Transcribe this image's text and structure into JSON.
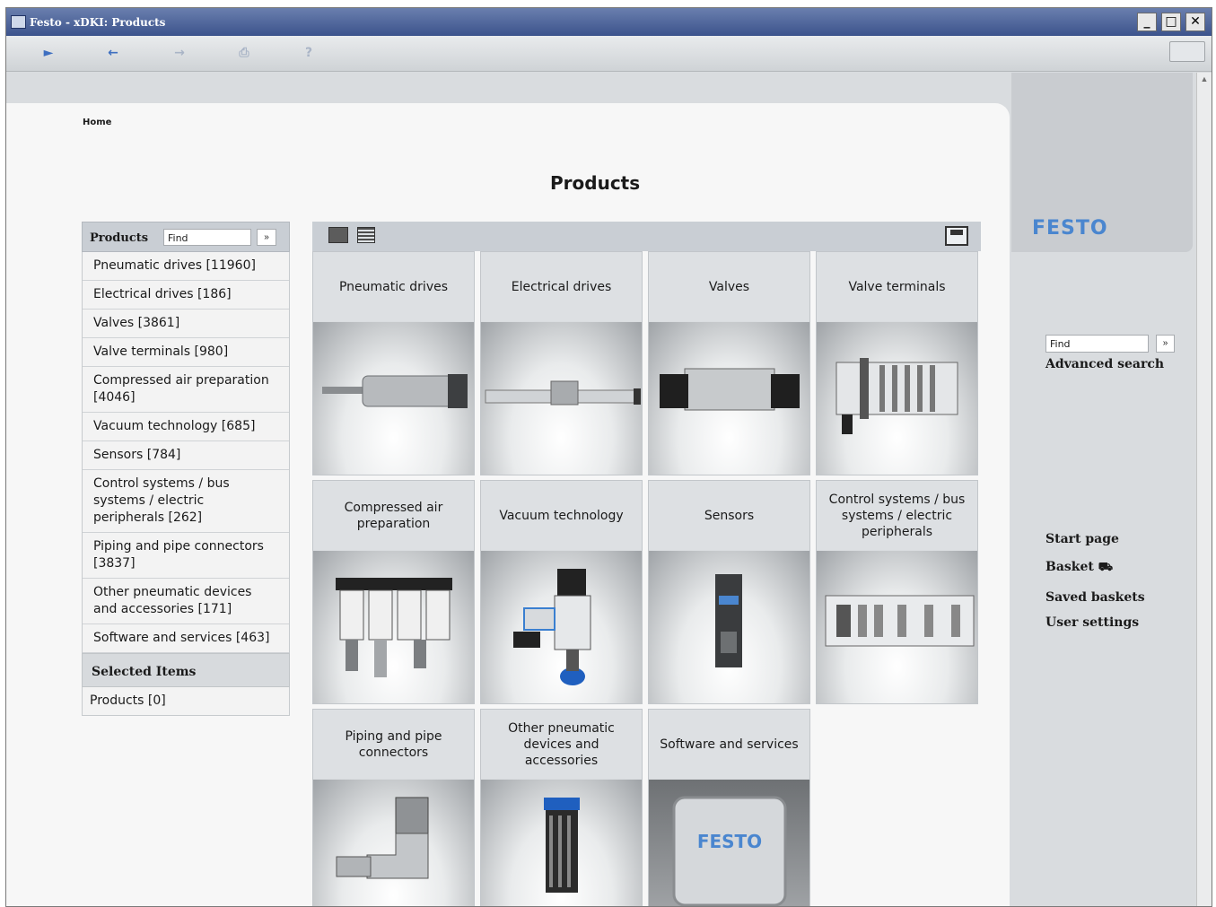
{
  "window": {
    "title": "Festo - xDKI: Products",
    "controls": {
      "minimize": "_",
      "maximize": "□",
      "close": "✕"
    }
  },
  "toolbar": {
    "home_icon": "home-arrow-icon",
    "back_icon": "back-arrow-icon",
    "forward_icon": "forward-arrow-icon",
    "print_icon": "print-icon",
    "help_label": "?"
  },
  "breadcrumb": "Home",
  "page_title": "Products",
  "sidebar": {
    "header_label": "Products",
    "find_value": "Find",
    "find_go": "»",
    "items": [
      "Pneumatic drives [11960]",
      "Electrical drives [186]",
      "Valves [3861]",
      "Valve terminals [980]",
      "Compressed air preparation [4046]",
      "Vacuum technology [685]",
      "Sensors [784]",
      "Control systems / bus systems / electric peripherals [262]",
      "Piping and pipe connectors [3837]",
      "Other pneumatic devices and accessories [171]",
      "Software and services [463]"
    ],
    "selected_header": "Selected Items",
    "selected_products": "Products [0]"
  },
  "categories": [
    "Pneumatic drives",
    "Electrical drives",
    "Valves",
    "Valve terminals",
    "Compressed air preparation",
    "Vacuum technology",
    "Sensors",
    "Control systems / bus systems / electric peripherals",
    "Piping and pipe connectors",
    "Other pneumatic devices and accessories",
    "Software and services"
  ],
  "software_key_text": "FESTO",
  "logo": "FESTO",
  "right_panel": {
    "find_value": "Find",
    "find_go": "»",
    "advanced_search": "Advanced search",
    "links": [
      "Start page",
      "Basket",
      "Saved baskets",
      "User settings"
    ]
  },
  "colors": {
    "brand": "#4a86cf",
    "titlebar": "#3c538c"
  }
}
